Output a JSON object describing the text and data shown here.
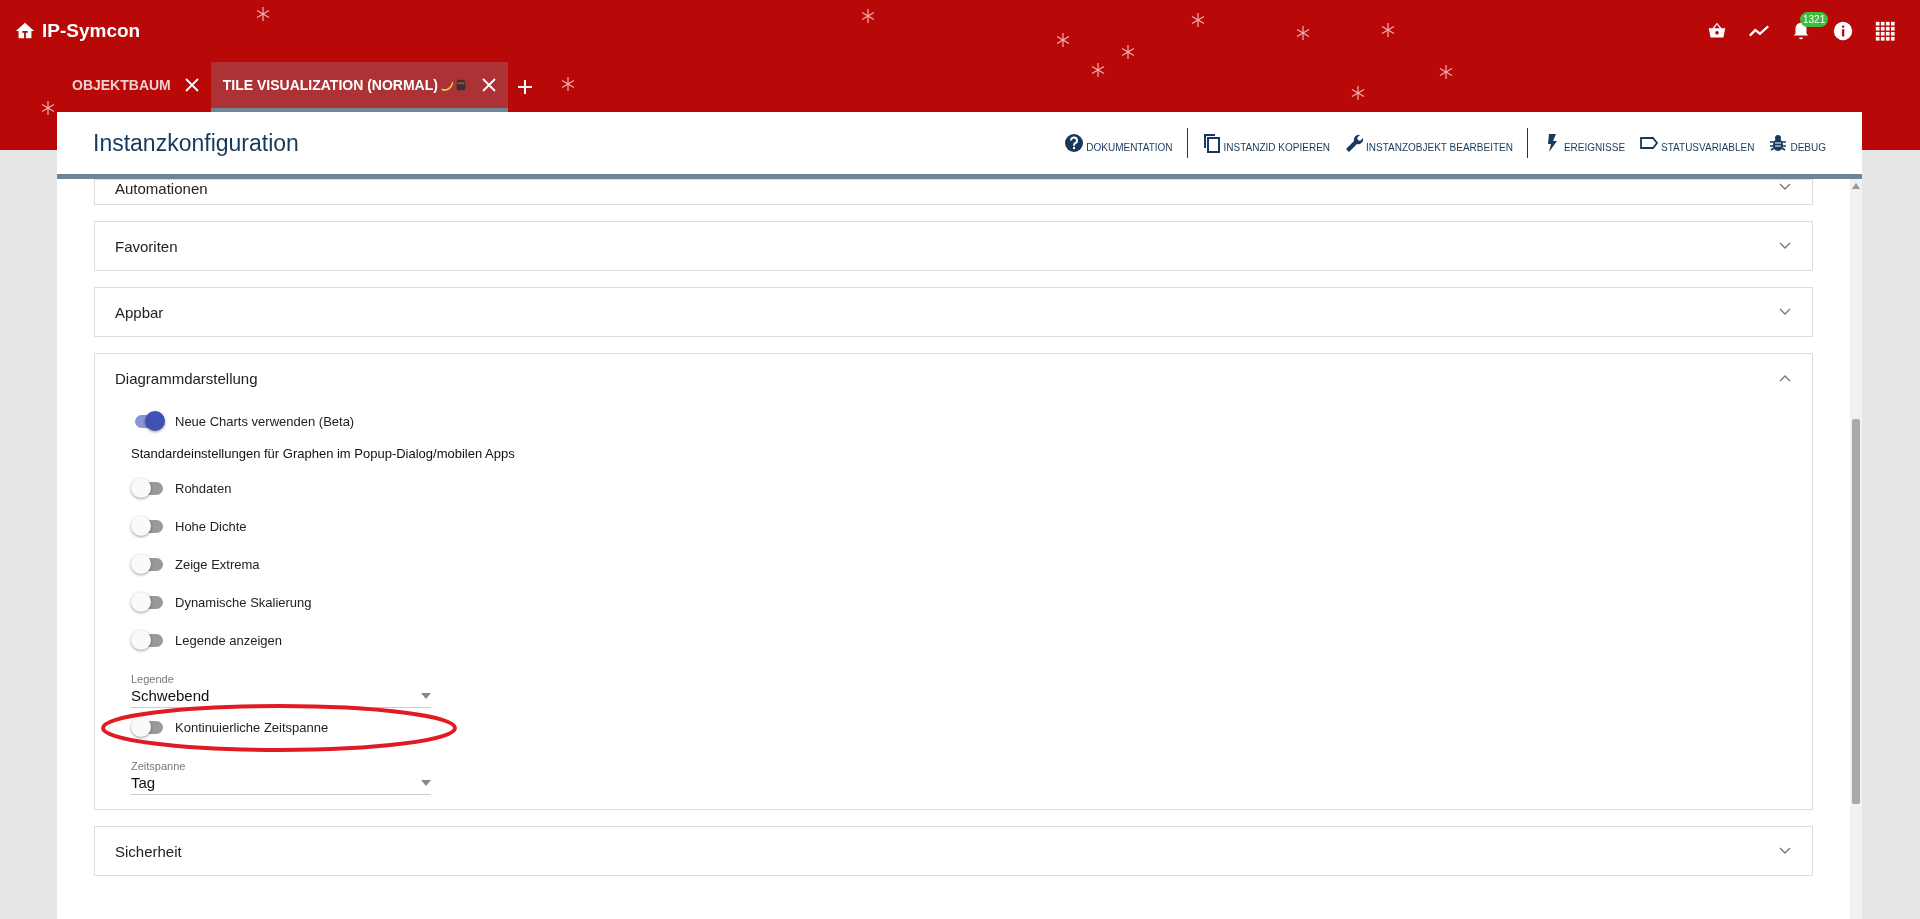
{
  "app": {
    "title": "IP-Symcon",
    "notification_count": "1321"
  },
  "tabs": [
    {
      "label": "OBJEKTBAUM",
      "selected": false
    },
    {
      "label": "TILE VISUALIZATION (NORMAL)",
      "selected": true,
      "emoji": true
    }
  ],
  "dialog": {
    "title": "Instanzkonfiguration",
    "actions": [
      {
        "label": "DOKUMENTATION",
        "kind": "help",
        "divider_after": true
      },
      {
        "label": "INSTANZID KOPIEREN",
        "kind": "copy",
        "divider_after": false
      },
      {
        "label": "INSTANZOBJEKT BEARBEITEN",
        "kind": "wrench",
        "divider_after": true
      },
      {
        "label": "EREIGNISSE",
        "kind": "bolt",
        "divider_after": false
      },
      {
        "label": "STATUSVARIABLEN",
        "kind": "tag",
        "divider_after": false
      },
      {
        "label": "DEBUG",
        "kind": "bug",
        "divider_after": false
      }
    ]
  },
  "sections": [
    {
      "title": "Automationen",
      "expanded": false,
      "clipped": true
    },
    {
      "title": "Favoriten",
      "expanded": false
    },
    {
      "title": "Appbar",
      "expanded": false
    },
    {
      "title": "Diagrammdarstellung",
      "expanded": true,
      "controls": [
        {
          "kind": "toggle",
          "label": "Neue Charts verwenden (Beta)",
          "checked": true
        },
        {
          "kind": "heading",
          "label": "Standardeinstellungen für Graphen im Popup-Dialog/mobilen Apps"
        },
        {
          "kind": "toggle",
          "label": "Rohdaten",
          "checked": false
        },
        {
          "kind": "toggle",
          "label": "Hohe Dichte",
          "checked": false
        },
        {
          "kind": "toggle",
          "label": "Zeige Extrema",
          "checked": false
        },
        {
          "kind": "toggle",
          "label": "Dynamische Skalierung",
          "checked": false
        },
        {
          "kind": "toggle",
          "label": "Legende anzeigen",
          "checked": false
        },
        {
          "kind": "select",
          "label": "Legende",
          "value": "Schwebend"
        },
        {
          "kind": "toggle",
          "label": "Kontinuierliche Zeitspanne",
          "checked": false,
          "highlighted": true
        },
        {
          "kind": "select",
          "label": "Zeitspanne",
          "value": "Tag"
        }
      ]
    },
    {
      "title": "Sicherheit",
      "expanded": false
    }
  ]
}
